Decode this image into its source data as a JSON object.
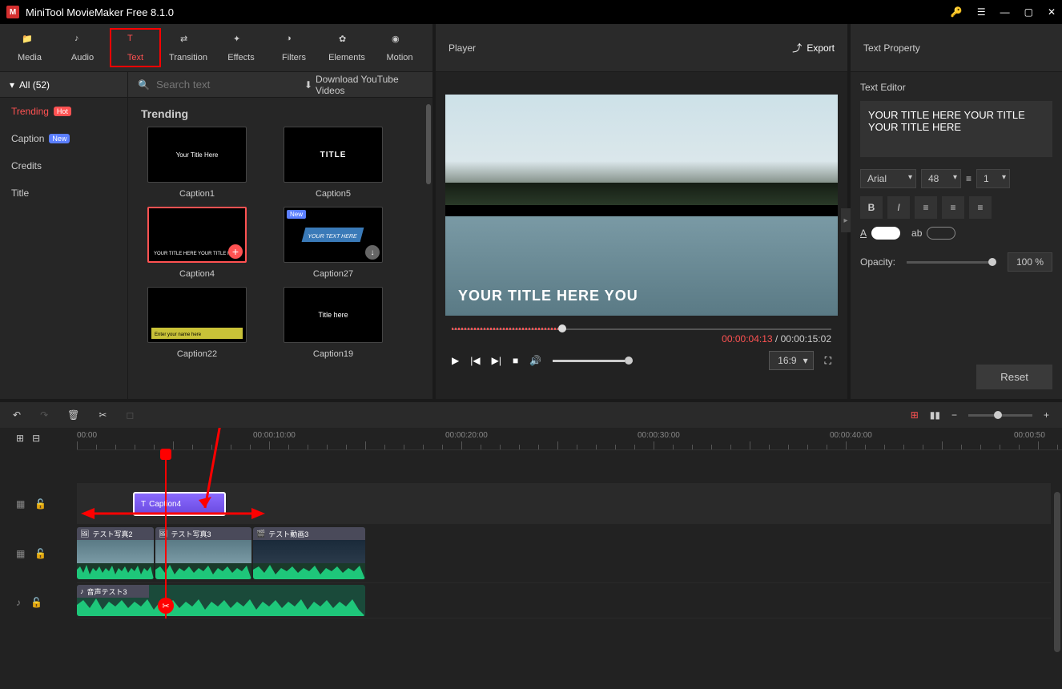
{
  "app": {
    "title": "MiniTool MovieMaker Free 8.1.0"
  },
  "tools": {
    "media": "Media",
    "audio": "Audio",
    "text": "Text",
    "transition": "Transition",
    "effects": "Effects",
    "filters": "Filters",
    "elements": "Elements",
    "motion": "Motion"
  },
  "player": {
    "label": "Player",
    "export": "Export",
    "caption_overlay": "YOUR TITLE HERE YOU",
    "current": "00:00:04:13",
    "total": "00:00:15:02",
    "sep": " / ",
    "aspect": "16:9"
  },
  "sidebar": {
    "all": "All (52)",
    "items": [
      {
        "label": "Trending",
        "badge": "Hot",
        "active": true
      },
      {
        "label": "Caption",
        "badge": "New"
      },
      {
        "label": "Credits"
      },
      {
        "label": "Title"
      }
    ]
  },
  "content": {
    "search_placeholder": "Search text",
    "download_link": "Download YouTube Videos",
    "section": "Trending",
    "thumbs": [
      {
        "label": "Caption1",
        "preview": "Your Title Here"
      },
      {
        "label": "Caption5",
        "preview": "TITLE"
      },
      {
        "label": "Caption4",
        "preview": "YOUR TITLE HERE YOUR TITLE HERE",
        "selected": true
      },
      {
        "label": "Caption27",
        "preview": "YOUR TEXT HERE",
        "new": true
      },
      {
        "label": "Caption22",
        "preview": "Enter your name here"
      },
      {
        "label": "Caption19",
        "preview": "Title here"
      }
    ]
  },
  "property": {
    "header": "Text Property",
    "section": "Text Editor",
    "text_value": "YOUR TITLE HERE YOUR TITLE YOUR TITLE HERE",
    "font": "Arial",
    "size": "48",
    "spacing": "1",
    "opacity_label": "Opacity:",
    "opacity_value": "100 %",
    "reset": "Reset"
  },
  "timeline": {
    "ruler": [
      "00:00",
      "00:00:10:00",
      "00:00:20:00",
      "00:00:30:00",
      "00:00:40:00",
      "00:00:50"
    ],
    "text_clip": "Caption4",
    "video_clips": [
      {
        "label": "テスト写真2"
      },
      {
        "label": "テスト写真3"
      },
      {
        "label": "テスト動画3"
      }
    ],
    "audio_clip": "音声テスト3"
  }
}
